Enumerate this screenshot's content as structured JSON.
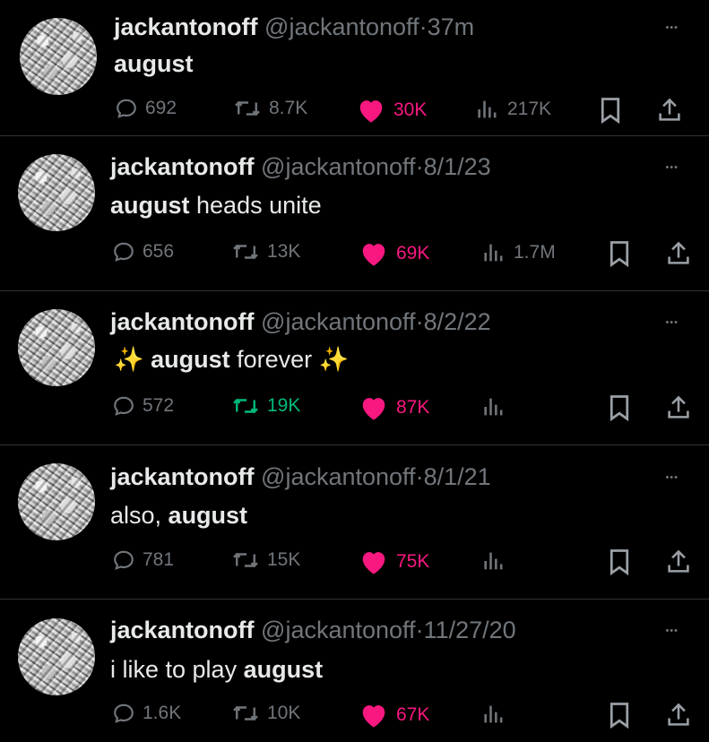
{
  "colors": {
    "like": "#f91880",
    "retweet": "#00ba7c",
    "muted": "#71767b",
    "text": "#e7e9ea",
    "background": "#000000"
  },
  "tweets": [
    {
      "username": "jackantonoff",
      "handle": "@jackantonoff",
      "separator": "·",
      "time": "37m",
      "text_parts": [
        {
          "text": "august",
          "bold": true
        }
      ],
      "replies": "692",
      "retweets": "8.7K",
      "likes": "30K",
      "views": "217K",
      "liked": true,
      "retweeted": false
    },
    {
      "username": "jackantonoff",
      "handle": "@jackantonoff",
      "separator": "·",
      "time": "8/1/23",
      "text_parts": [
        {
          "text": "august",
          "bold": true
        },
        {
          "text": " heads unite",
          "bold": false
        }
      ],
      "replies": "656",
      "retweets": "13K",
      "likes": "69K",
      "views": "1.7M",
      "liked": true,
      "retweeted": false
    },
    {
      "username": "jackantonoff",
      "handle": "@jackantonoff",
      "separator": "·",
      "time": "8/2/22",
      "text_parts": [
        {
          "text": "✨ ",
          "bold": false,
          "sparkle": true
        },
        {
          "text": "august",
          "bold": true
        },
        {
          "text": " forever ",
          "bold": false
        },
        {
          "text": "✨",
          "bold": false,
          "sparkle": true
        }
      ],
      "replies": "572",
      "retweets": "19K",
      "likes": "87K",
      "views": "",
      "liked": true,
      "retweeted": true
    },
    {
      "username": "jackantonoff",
      "handle": "@jackantonoff",
      "separator": "·",
      "time": "8/1/21",
      "text_parts": [
        {
          "text": "also, ",
          "bold": false
        },
        {
          "text": "august",
          "bold": true
        }
      ],
      "replies": "781",
      "retweets": "15K",
      "likes": "75K",
      "views": "",
      "liked": true,
      "retweeted": false
    },
    {
      "username": "jackantonoff",
      "handle": "@jackantonoff",
      "separator": "·",
      "time": "11/27/20",
      "text_parts": [
        {
          "text": "i like to play ",
          "bold": false
        },
        {
          "text": "august",
          "bold": true
        }
      ],
      "replies": "1.6K",
      "retweets": "10K",
      "likes": "67K",
      "views": "",
      "liked": true,
      "retweeted": false
    }
  ],
  "icons": [
    "reply-icon",
    "retweet-icon",
    "heart-icon",
    "views-icon",
    "bookmark-icon",
    "share-icon",
    "more-icon"
  ]
}
